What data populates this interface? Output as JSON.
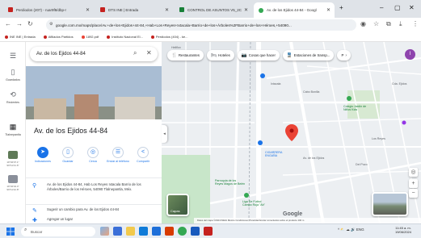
{
  "browser": {
    "tabs": [
      {
        "label": "Perdiodos (207) - ruar9f8/dbp-r",
        "favicon_color": "#c5221f"
      },
      {
        "label": "DTS INE | Entrada",
        "favicon_color": "#c5221f"
      },
      {
        "label": "CONTROL DE ASUNTOS V5_2C",
        "favicon_color": "#188038"
      },
      {
        "label": "Av. de los Ejidos 44-84 - Googl",
        "favicon_color": "#34a853"
      }
    ],
    "new_tab": "+",
    "window_controls": {
      "minimize": "–",
      "maximize": "▢",
      "close": "✕"
    },
    "url": "google.com.mx/maps/place/Av.+de+los+Ejidos+44-84,+Hab+Los+Reyes+Ixtacala+Barrio+de+los+Árboles%2FBarrio+de+los+Héroes,+54090...",
    "bookmarks": [
      {
        "label": "INE INE | Entrada",
        "color": "#c5221f"
      },
      {
        "label": "Afiliados Partidos",
        "color": "#c5221f"
      },
      {
        "label": "1892.pdf",
        "color": "#ea4335"
      },
      {
        "label": "Instituto Nacional El...",
        "color": "#c5221f"
      },
      {
        "label": "Perdiodos (404) - ke...",
        "color": "#c5221f"
      }
    ]
  },
  "rail": {
    "items": [
      {
        "label": "Guardados",
        "icon": "bookmark-icon"
      },
      {
        "label": "Recientes",
        "icon": "history-icon"
      },
      {
        "label": "Tlalnepantla"
      }
    ],
    "thumb_captions": [
      "19°32'07.1\"\n99°11'41.6\"",
      "19°32'04.4\"\n99°11'42.8\""
    ]
  },
  "panel": {
    "search_value": "Av. de los Ejidos 44-84",
    "title": "Av. de los Ejidos 44-84",
    "actions": [
      {
        "label": "Indicaciones",
        "icon": "directions-icon"
      },
      {
        "label": "Guardar",
        "icon": "bookmark-icon"
      },
      {
        "label": "Cerca",
        "icon": "nearby-icon"
      },
      {
        "label": "Enviar al teléfono",
        "icon": "phone-icon"
      },
      {
        "label": "Compartir",
        "icon": "share-icon"
      }
    ],
    "address": "Av. de los Ejidos 44-84, Hab Los Reyes Ixtacala Barrio de los Árboles/Barrio de los Héroes, 54090 Tlalnepantla, Méx.",
    "suggest": "Sugerir un cambio para Av. de los Ejidos 44-84",
    "add_place": "Agregar un lugar"
  },
  "map": {
    "chips": [
      {
        "label": "Restaurantes",
        "icon": "restaurant-icon"
      },
      {
        "label": "Hoteles",
        "icon": "hotel-icon"
      },
      {
        "label": "Cosas que hacer",
        "icon": "camera-icon"
      },
      {
        "label": "Estaciones de transp...",
        "icon": "transit-icon"
      },
      {
        "label": "P",
        "icon": "parking-icon"
      }
    ],
    "avatar_letter": "I",
    "labels": {
      "heliflox": "Heliflox",
      "cigarrera": "CIGARRERA\nENGAÑA",
      "ixtacala": "Ixtacala",
      "colegio": "Colegio Jardín de\nNiños Kids",
      "cabo_bonilla": "Cabo Bonilla",
      "bicentenario": "Parroquia de los\nReyes Magos de Belén",
      "futbol": "Liga De Futbol\nCampo Roja \"Ab\"",
      "calle_ejidos": "Av. de los Ejidos",
      "del_pozo": "Del Pozo",
      "los_reyes": "Los Reyes",
      "cda_ejidos": "Cda. Ejidos"
    },
    "layers_label": "Capas",
    "google_logo": "Google",
    "attribution": "Datos del mapa ©2024 INEGI   México   Condiciones   Privacidad   Enviar comentarios sobre el producto   100 m"
  },
  "taskbar": {
    "search_placeholder": "Buscar",
    "tray": "^  ⛅  ☁  🔊  ENG",
    "time": "11:45 a. m.",
    "date": "19/06/2024"
  },
  "colors": {
    "accent": "#1a73e8",
    "pin": "#ea4335",
    "park": "#c8e6c9",
    "road": "#ffffff"
  }
}
